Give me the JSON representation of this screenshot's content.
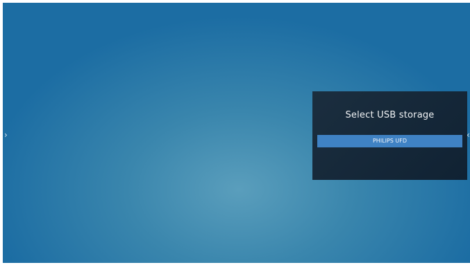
{
  "screen": {
    "nav_left_icon": "chevron-right-icon",
    "nav_right_icon": "chevron-left-icon",
    "background_color": "#1c6da3"
  },
  "dialog": {
    "title": "Select USB storage",
    "options": [
      {
        "label": "PHILIPS UFD",
        "selected": true
      }
    ],
    "highlight_color": "#3f82c4",
    "background_color": "#132536"
  }
}
